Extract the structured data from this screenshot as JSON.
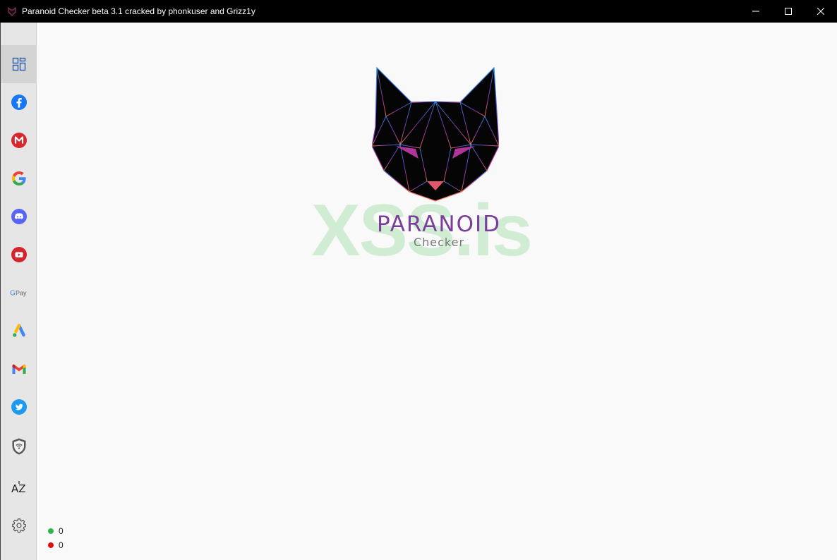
{
  "window": {
    "title": "Paranoid Checker beta 3.1 cracked by phonkuser and Grizz1y"
  },
  "titlebar": {
    "buttons": [
      "minimize-icon",
      "maximize-icon",
      "close-icon"
    ]
  },
  "sidebar": {
    "items": [
      {
        "icon": "dashboard-icon",
        "active": true
      },
      {
        "icon": "facebook-icon"
      },
      {
        "icon": "mega-icon"
      },
      {
        "icon": "google-icon"
      },
      {
        "icon": "discord-icon"
      },
      {
        "icon": "youtube-icon"
      },
      {
        "icon": "gpay-icon",
        "label": "G Pay"
      },
      {
        "icon": "google-ads-icon"
      },
      {
        "icon": "gmail-icon"
      },
      {
        "icon": "twitter-icon"
      },
      {
        "icon": "vpn-shield-icon"
      },
      {
        "icon": "sort-az-icon",
        "label": "AZ"
      },
      {
        "icon": "gear-icon"
      }
    ]
  },
  "brand": {
    "name": "PARANOID",
    "subtitle": "Checker"
  },
  "watermark": "XSS.is",
  "status": {
    "good_count": "0",
    "bad_count": "0",
    "good_color": "#2fb84a",
    "bad_color": "#e01010"
  }
}
